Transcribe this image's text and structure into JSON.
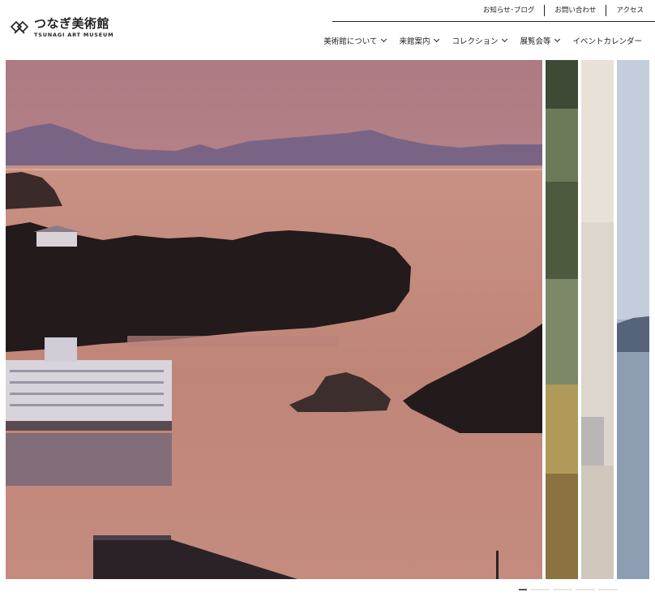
{
  "logo": {
    "name": "つなぎ美術館",
    "name_en": "TSUNAGI ART MUSEUM"
  },
  "utility_nav": [
    {
      "label": "お知らせ･ブログ"
    },
    {
      "label": "お問い合わせ"
    },
    {
      "label": "アクセス"
    }
  ],
  "main_nav": [
    {
      "label": "美術館について",
      "has_dropdown": true
    },
    {
      "label": "来館案内",
      "has_dropdown": true
    },
    {
      "label": "コレクション",
      "has_dropdown": true
    },
    {
      "label": "展覧会等",
      "has_dropdown": true
    },
    {
      "label": "イベントカレンダー",
      "has_dropdown": false
    }
  ],
  "hero": {
    "slides_total": 5,
    "active_slide": 1
  },
  "colors": {
    "sky_top": "#b87f83",
    "sky_bottom": "#d39a8d",
    "water": "#c48a80",
    "mountains": "#7c6584",
    "trees": "#241c1c"
  }
}
